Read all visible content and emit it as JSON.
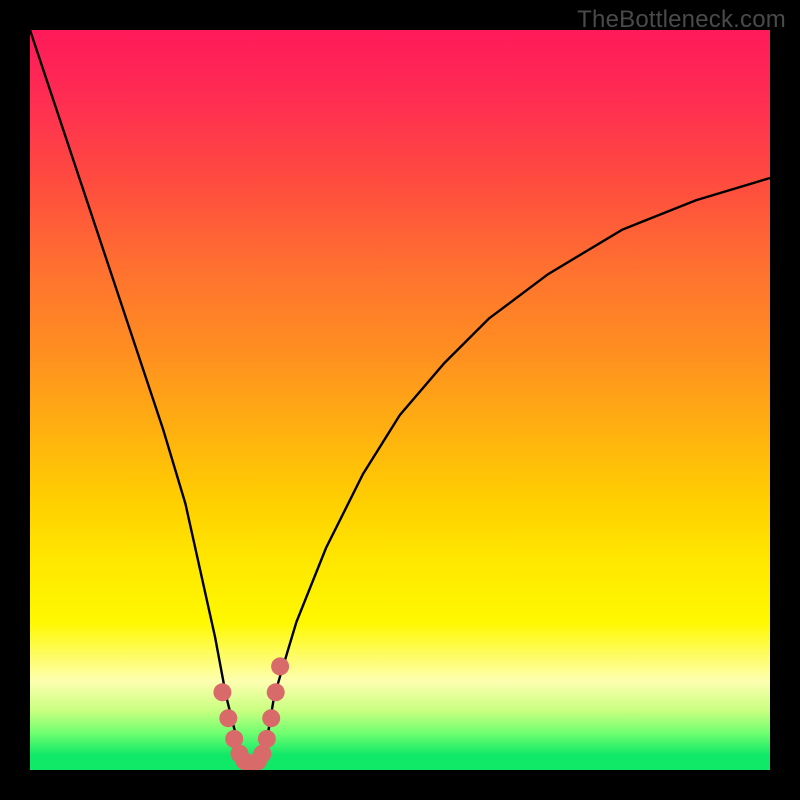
{
  "watermark": {
    "text": "TheBottleneck.com"
  },
  "chart_data": {
    "type": "line",
    "title": "",
    "xlabel": "",
    "ylabel": "",
    "xlim": [
      0,
      100
    ],
    "ylim": [
      0,
      100
    ],
    "series": [
      {
        "name": "bottleneck-curve",
        "x": [
          0,
          3,
          6,
          9,
          12,
          15,
          18,
          21,
          23,
          25,
          26.5,
          28,
          29,
          30,
          31,
          32,
          33,
          36,
          40,
          45,
          50,
          56,
          62,
          70,
          80,
          90,
          100
        ],
        "y": [
          100,
          91,
          82,
          73,
          64,
          55,
          46,
          36,
          27,
          18,
          10,
          4,
          1,
          0,
          1,
          4,
          10,
          20,
          30,
          40,
          48,
          55,
          61,
          67,
          73,
          77,
          80
        ]
      }
    ],
    "marker_cluster": {
      "name": "highlight-points",
      "color": "#d86a6a",
      "x": [
        26.0,
        26.8,
        27.6,
        28.3,
        29.0,
        29.6,
        30.2,
        30.8,
        31.4,
        32.0,
        32.6,
        33.2,
        33.8
      ],
      "y": [
        10.5,
        7.0,
        4.2,
        2.2,
        1.2,
        0.8,
        0.8,
        1.2,
        2.2,
        4.2,
        7.0,
        10.5,
        14.0
      ]
    },
    "colors": {
      "curve": "#000000",
      "markers": "#d86a6a",
      "gradient_top": "#ff1a5a",
      "gradient_bottom": "#10e868"
    }
  }
}
